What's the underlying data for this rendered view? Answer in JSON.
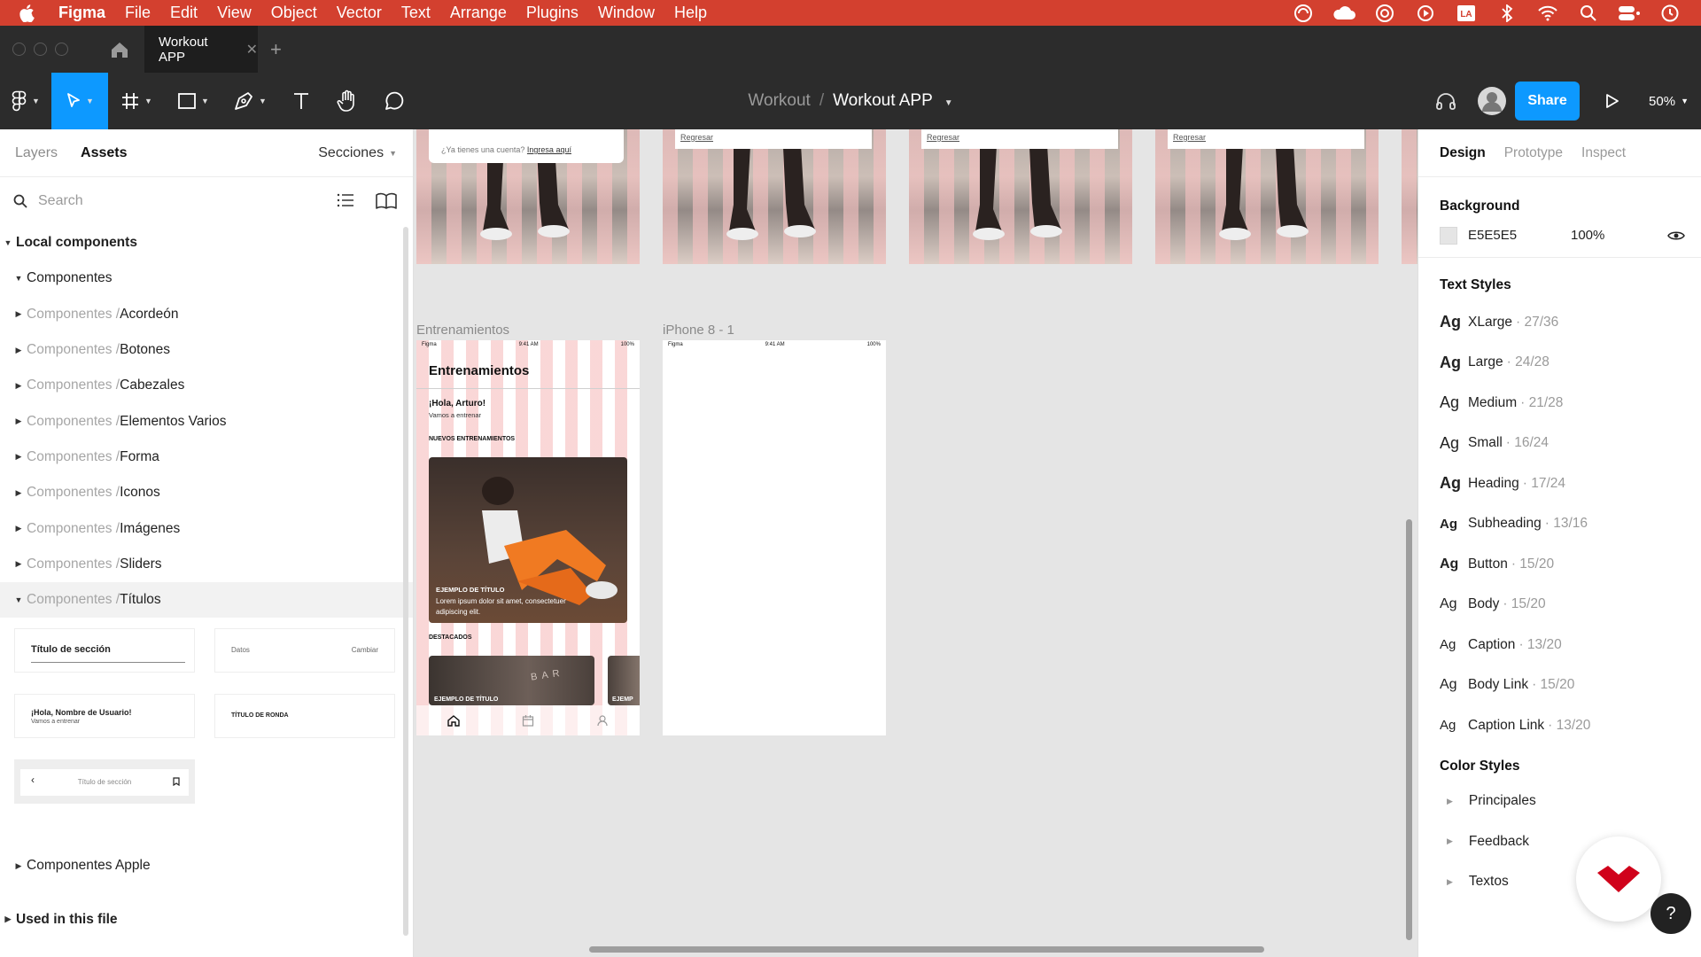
{
  "menubar": {
    "app": "Figma",
    "items": [
      "File",
      "Edit",
      "View",
      "Object",
      "Vector",
      "Text",
      "Arrange",
      "Plugins",
      "Window",
      "Help"
    ],
    "tray_icons": [
      "creative-cloud-icon",
      "cloud-icon",
      "network-icon",
      "play-icon",
      "la-icon",
      "bluetooth-icon",
      "wifi-icon",
      "search-icon",
      "control-center-icon",
      "time-machine-icon"
    ],
    "tray_la": "LA"
  },
  "tabbar": {
    "file_tab": "Workout APP"
  },
  "toolbar": {
    "project": "Workout",
    "separator": "/",
    "file": "Workout APP",
    "share": "Share",
    "zoom": "50%"
  },
  "left_panel": {
    "tabs": [
      "Layers",
      "Assets"
    ],
    "sections_label": "Secciones",
    "search_placeholder": "Search",
    "local_components": "Local components",
    "group": "Componentes",
    "prefix": "Componentes / ",
    "items": [
      "Acordeón",
      "Botones",
      "Cabezales",
      "Elementos Varios",
      "Forma",
      "Iconos",
      "Imágenes",
      "Sliders",
      "Títulos"
    ],
    "thumbs": {
      "section_title": "Título de sección",
      "datos": "Datos",
      "cambiar": "Cambiar",
      "hola": "¡Hola, Nombre de Usuario!",
      "hola_sub": "Vamos a entrenar",
      "ronda": "TÍTULO DE RONDA",
      "nav_title": "Título de sección"
    },
    "apple": "Componentes Apple",
    "used": "Used in this file"
  },
  "canvas": {
    "top_frame": {
      "question": "¿Ya tienes una cuenta?",
      "link": "Ingresa aquí",
      "back": "Regresar"
    },
    "frame1": {
      "label": "Entrenamientos",
      "status_carrier": "Figma",
      "status_time": "9:41 AM",
      "status_batt": "100%",
      "title": "Entrenamientos",
      "greet": "¡Hola, Arturo!",
      "greet_sub": "Vamos a entrenar",
      "new_section": "NUEVOS ENTRENAMIENTOS",
      "card_title": "EJEMPLO DE TÍTULO",
      "card_text": "Lorem ipsum dolor sit amet, consectetuer adipiscing elit.",
      "featured": "DESTACADOS",
      "featured_card": "EJEMPLO DE TÍTULO",
      "featured_card2": "EJEMP",
      "bar_sign": "BAR"
    },
    "frame2": {
      "label": "iPhone 8 - 1",
      "status_carrier": "Figma",
      "status_time": "9:41 AM",
      "status_batt": "100%"
    }
  },
  "right_panel": {
    "tabs": [
      "Design",
      "Prototype",
      "Inspect"
    ],
    "background_label": "Background",
    "bg_hex": "E5E5E5",
    "bg_opacity": "100%",
    "bg_color": "#e5e5e5",
    "text_styles_label": "Text Styles",
    "text_styles": [
      {
        "ag": "Ag",
        "name": "XLarge",
        "size": " · 27/36",
        "weight": "bold"
      },
      {
        "ag": "Ag",
        "name": "Large",
        "size": " · 24/28",
        "weight": "bold"
      },
      {
        "ag": "Ag",
        "name": "Medium",
        "size": " · 21/28",
        "weight": "normal"
      },
      {
        "ag": "Ag",
        "name": "Small",
        "size": " · 16/24",
        "weight": "normal"
      },
      {
        "ag": "Ag",
        "name": "Heading",
        "size": " · 17/24",
        "weight": "bold"
      },
      {
        "ag": "Ag",
        "name": "Subheading",
        "size": " · 13/16",
        "weight": "bold"
      },
      {
        "ag": "Ag",
        "name": "Button",
        "size": " · 15/20",
        "weight": "bold"
      },
      {
        "ag": "Ag",
        "name": "Body",
        "size": " · 15/20",
        "weight": "normal"
      },
      {
        "ag": "Ag",
        "name": "Caption",
        "size": " · 13/20",
        "weight": "normal"
      },
      {
        "ag": "Ag",
        "name": "Body Link",
        "size": " · 15/20",
        "weight": "normal"
      },
      {
        "ag": "Ag",
        "name": "Caption Link",
        "size": " · 13/20",
        "weight": "normal"
      }
    ],
    "color_styles_label": "Color Styles",
    "color_styles": [
      "Principales",
      "Feedback",
      "Textos"
    ],
    "help": "?"
  },
  "colors": {
    "menubar": "#d3402f",
    "accent": "#0d99ff",
    "brand_red": "#d0021b"
  }
}
